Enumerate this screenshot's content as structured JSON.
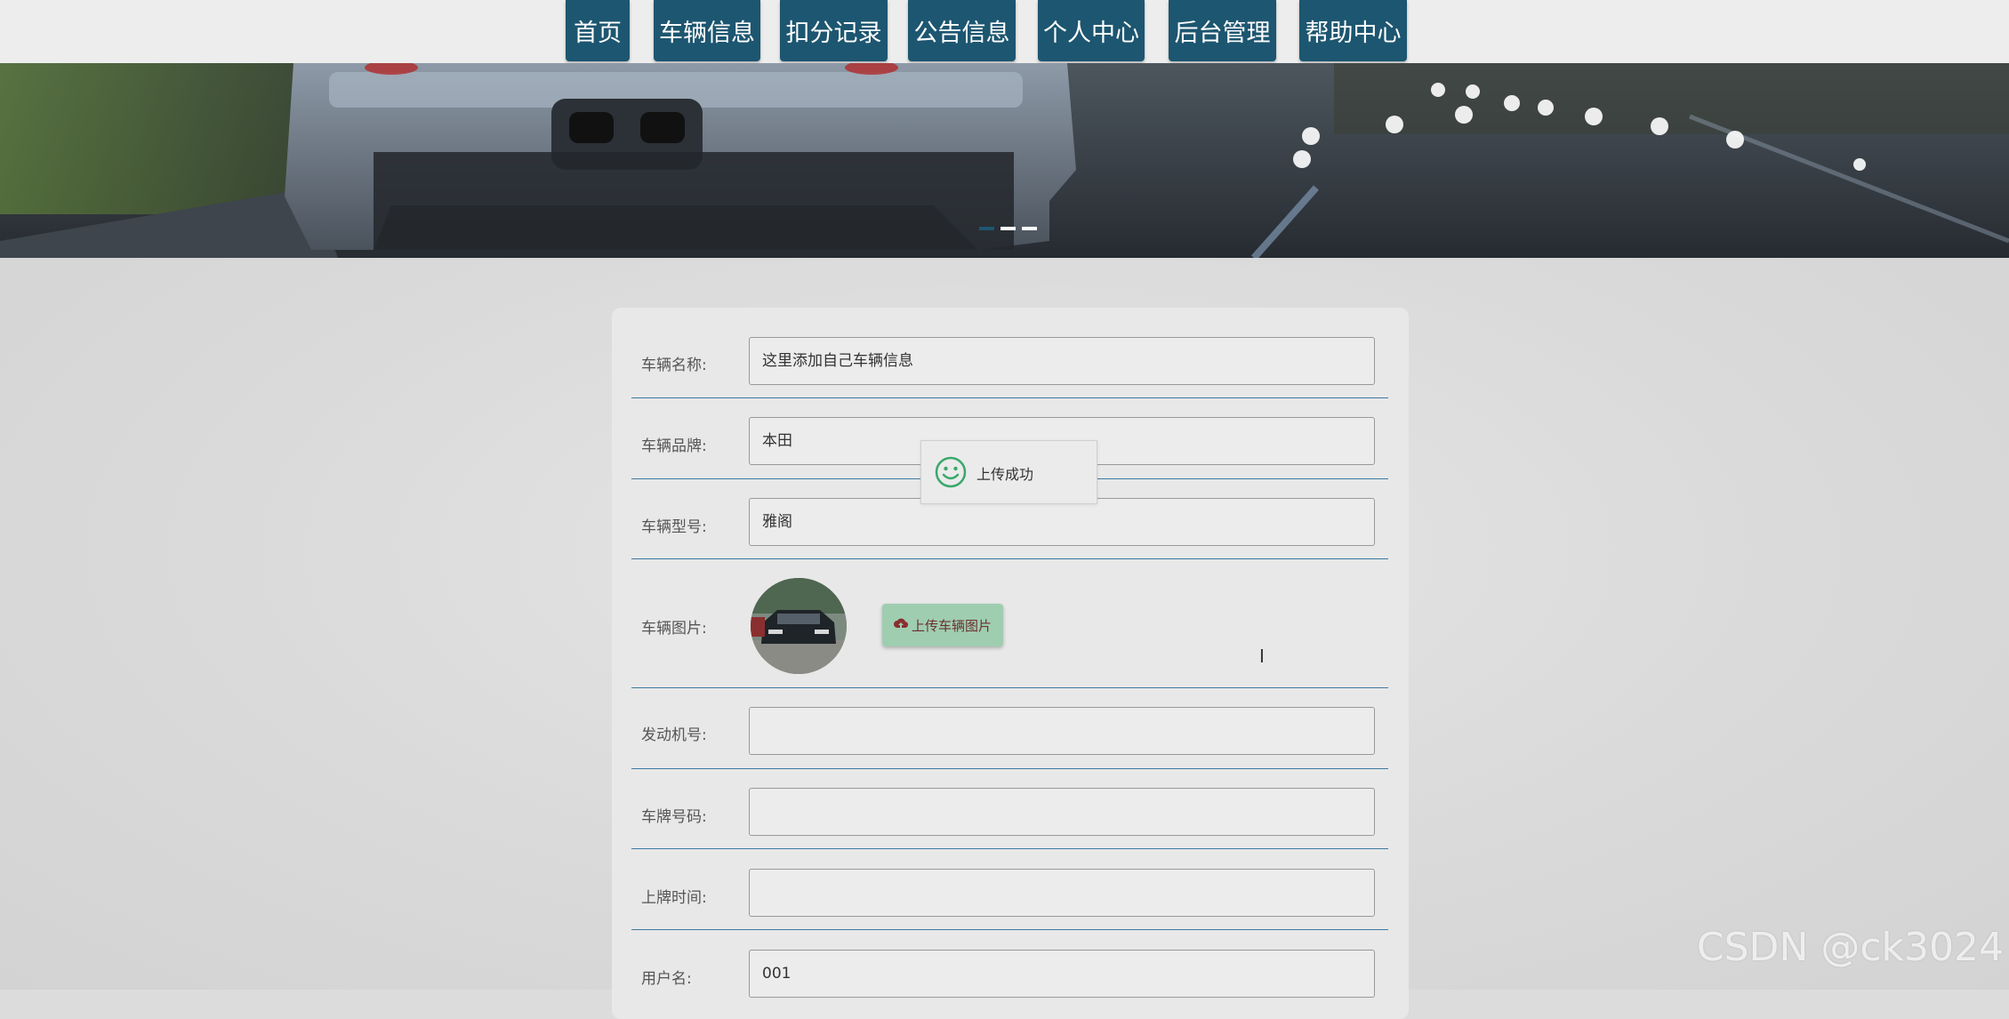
{
  "nav": {
    "items": [
      "首页",
      "车辆信息",
      "扣分记录",
      "公告信息",
      "个人中心",
      "后台管理",
      "帮助中心"
    ]
  },
  "banner": {
    "slides": 3,
    "active_slide": 1
  },
  "form": {
    "fields": [
      {
        "label": "车辆名称:",
        "value": "这里添加自己车辆信息"
      },
      {
        "label": "车辆品牌:",
        "value": "本田"
      },
      {
        "label": "车辆型号:",
        "value": "雅阁"
      }
    ],
    "image_field": {
      "label": "车辆图片:",
      "upload_label": "上传车辆图片"
    },
    "fields_after": [
      {
        "label": "发动机号:",
        "value": ""
      },
      {
        "label": "车牌号码:",
        "value": ""
      },
      {
        "label": "上牌时间:",
        "value": ""
      },
      {
        "label": "用户名:",
        "value": "001"
      }
    ]
  },
  "toast": {
    "message": "上传成功"
  },
  "watermark": "CSDN @ck3024",
  "colors": {
    "nav_bg": "#1d5670",
    "row_divider": "#3d7aa0",
    "upload_button": "#9fcdb0",
    "toast_icon": "#3aa86a"
  }
}
